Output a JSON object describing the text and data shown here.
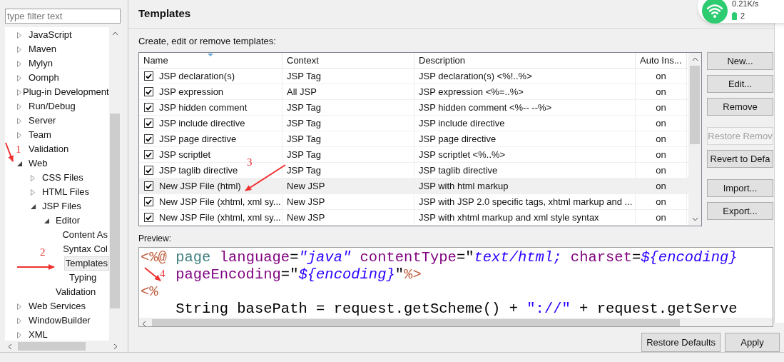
{
  "sidebar": {
    "filter": {
      "placeholder": "type filter text"
    },
    "tree": [
      {
        "label": "JavaScript",
        "expanded": false,
        "selected": false
      },
      {
        "label": "Maven",
        "expanded": false,
        "selected": false
      },
      {
        "label": "Mylyn",
        "expanded": false,
        "selected": false
      },
      {
        "label": "Oomph",
        "expanded": false,
        "selected": false
      },
      {
        "label": "Plug-in Development",
        "expanded": false,
        "selected": false
      },
      {
        "label": "Run/Debug",
        "expanded": false,
        "selected": false
      },
      {
        "label": "Server",
        "expanded": false,
        "selected": false
      },
      {
        "label": "Team",
        "expanded": false,
        "selected": false
      },
      {
        "label": "Validation",
        "selected": false
      },
      {
        "label": "Web",
        "expanded": true,
        "selected": false,
        "children": [
          {
            "label": "CSS Files",
            "expanded": false,
            "selected": false
          },
          {
            "label": "HTML Files",
            "expanded": false,
            "selected": false
          },
          {
            "label": "JSP Files",
            "expanded": true,
            "selected": false,
            "children": [
              {
                "label": "Editor",
                "expanded": true,
                "selected": false,
                "children": [
                  {
                    "label": "Content As",
                    "selected": false
                  },
                  {
                    "label": "Syntax Col",
                    "selected": false
                  },
                  {
                    "label": "Templates",
                    "selected": true
                  },
                  {
                    "label": "Typing",
                    "selected": false
                  }
                ]
              },
              {
                "label": "Validation",
                "selected": false
              }
            ]
          }
        ]
      },
      {
        "label": "Web Services",
        "expanded": false,
        "selected": false
      },
      {
        "label": "WindowBuilder",
        "expanded": false,
        "selected": false
      },
      {
        "label": "XML",
        "expanded": false,
        "selected": false
      }
    ]
  },
  "page": {
    "title": "Templates",
    "intro": "Create, edit or remove templates:",
    "table": {
      "columns": [
        "Name",
        "Context",
        "Description",
        "Auto Ins..."
      ],
      "rows": [
        {
          "checked": true,
          "selected": false,
          "cells": [
            "JSP declaration(s)",
            "JSP Tag",
            "JSP declaration(s) <%!..%>",
            "on"
          ]
        },
        {
          "checked": true,
          "selected": false,
          "cells": [
            "JSP expression",
            "All JSP",
            "JSP expression <%=..%>",
            "on"
          ]
        },
        {
          "checked": true,
          "selected": false,
          "cells": [
            "JSP hidden comment",
            "JSP Tag",
            "JSP hidden comment <%-- --%>",
            "on"
          ]
        },
        {
          "checked": true,
          "selected": false,
          "cells": [
            "JSP include directive",
            "JSP Tag",
            "JSP include directive",
            "on"
          ]
        },
        {
          "checked": true,
          "selected": false,
          "cells": [
            "JSP page directive",
            "JSP Tag",
            "JSP page directive",
            "on"
          ]
        },
        {
          "checked": true,
          "selected": false,
          "cells": [
            "JSP scriptlet",
            "JSP Tag",
            "JSP scriptlet <%..%>",
            "on"
          ]
        },
        {
          "checked": true,
          "selected": false,
          "cells": [
            "JSP taglib directive",
            "JSP Tag",
            "JSP taglib directive",
            "on"
          ]
        },
        {
          "checked": true,
          "selected": true,
          "cells": [
            "New JSP File (html)",
            "New JSP",
            "JSP with html markup",
            "on"
          ]
        },
        {
          "checked": true,
          "selected": false,
          "cells": [
            "New JSP File (xhtml, xml sy...",
            "New JSP",
            "JSP with JSP 2.0 specific tags, xhtml markup and ...",
            "on"
          ]
        },
        {
          "checked": true,
          "selected": false,
          "cells": [
            "New JSP File (xhtml, xml sy...",
            "New JSP",
            "JSP with xhtml markup and xml style syntax",
            "on"
          ]
        }
      ]
    },
    "button_groups": [
      [
        {
          "label": "New...",
          "disabled": false
        },
        {
          "label": "Edit...",
          "disabled": false
        },
        {
          "label": "Remove",
          "disabled": false
        }
      ],
      [
        {
          "label": "Restore Remov",
          "disabled": true
        },
        {
          "label": "Revert to Defa",
          "disabled": false
        }
      ],
      [
        {
          "label": "Import...",
          "disabled": false
        },
        {
          "label": "Export...",
          "disabled": false
        }
      ]
    ],
    "preview": {
      "label": "Preview:",
      "lines": [
        {
          "indent": false,
          "tokens": [
            {
              "kind": "delimiter",
              "text": "<%@"
            },
            {
              "kind": "directive",
              "text": " page"
            },
            {
              "kind": "attribute",
              "text": " language"
            },
            {
              "kind": "plain",
              "text": "="
            },
            {
              "kind": "value",
              "text": "\"java\""
            },
            {
              "kind": "attribute",
              "text": " contentType"
            },
            {
              "kind": "plain",
              "text": "=\""
            },
            {
              "kind": "value",
              "text": "text/html;"
            },
            {
              "kind": "attribute",
              "text": " charset"
            },
            {
              "kind": "plain",
              "text": "="
            },
            {
              "kind": "value",
              "text": "${encoding}"
            }
          ]
        },
        {
          "indent": true,
          "tokens": [
            {
              "kind": "attribute",
              "text": "pageEncoding"
            },
            {
              "kind": "plain",
              "text": "=\""
            },
            {
              "kind": "value",
              "text": "${encoding}"
            },
            {
              "kind": "plain",
              "text": "\""
            },
            {
              "kind": "delimiter",
              "text": "%>"
            }
          ]
        },
        {
          "indent": false,
          "tokens": [
            {
              "kind": "delimiter",
              "text": "<%"
            }
          ]
        },
        {
          "indent": true,
          "tokens": [
            {
              "kind": "plain",
              "text": "String basePath = request.getScheme() + "
            },
            {
              "kind": "string",
              "text": "\"://\""
            },
            {
              "kind": "plain",
              "text": " + request.getServe"
            }
          ]
        }
      ]
    },
    "footer_buttons": [
      "Restore Defaults",
      "Apply"
    ]
  },
  "annotations": [
    "1",
    "2",
    "3",
    "4"
  ],
  "hotspot_widget": {
    "speed": "0.21K/s",
    "devices": "2"
  }
}
